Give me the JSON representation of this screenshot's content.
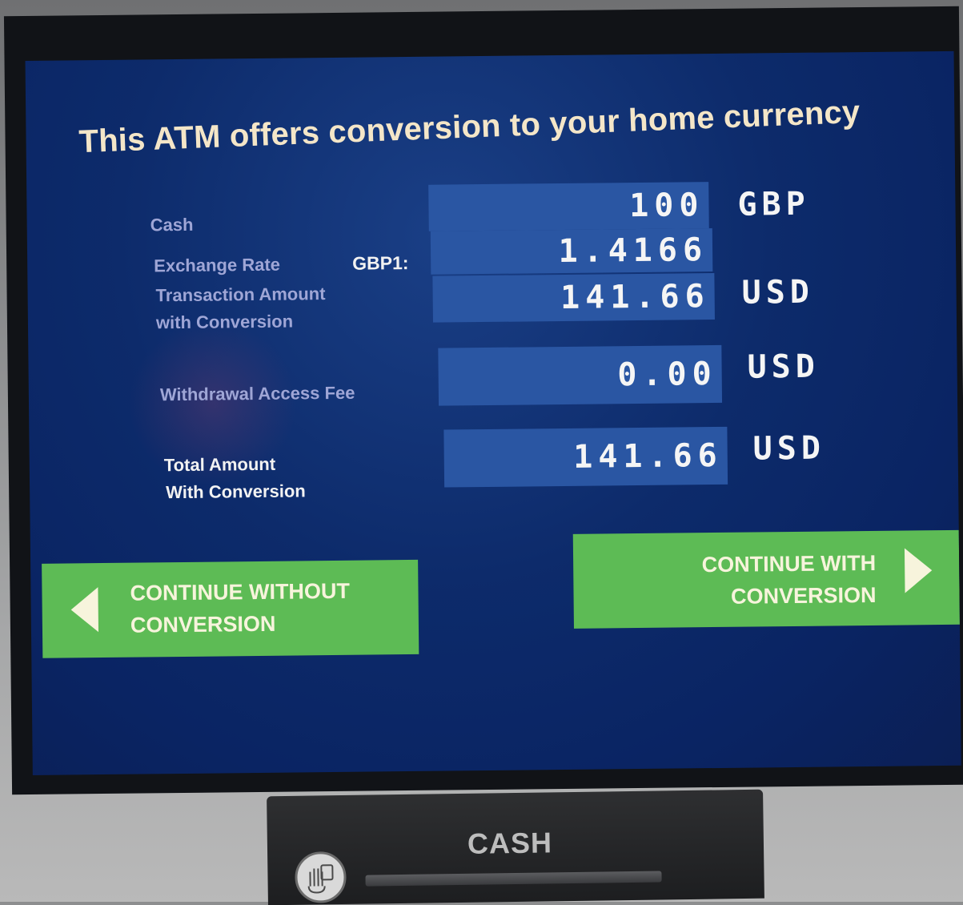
{
  "screen": {
    "title": "This ATM offers conversion to your home currency"
  },
  "rows": {
    "cash": {
      "label": "Cash",
      "value": "100",
      "currency": "GBP"
    },
    "exchange_rate": {
      "label": "Exchange Rate",
      "prefix": "GBP1:",
      "value": "1.4166"
    },
    "transaction_amount": {
      "label_line1": "Transaction Amount",
      "label_line2": "with Conversion",
      "value": "141.66",
      "currency": "USD"
    },
    "withdrawal_fee": {
      "label": "Withdrawal Access Fee",
      "value": "0.00",
      "currency": "USD"
    },
    "total_amount": {
      "label_line1": "Total Amount",
      "label_line2": "With Conversion",
      "value": "141.66",
      "currency": "USD"
    }
  },
  "buttons": {
    "without_conversion": {
      "line1": "CONTINUE WITHOUT",
      "line2": "CONVERSION",
      "icon": "arrow-left-icon"
    },
    "with_conversion": {
      "line1": "CONTINUE WITH",
      "line2": "CONVERSION",
      "icon": "arrow-right-icon"
    }
  },
  "dispenser": {
    "label": "CASH",
    "icon": "hand-card-icon"
  },
  "colors": {
    "screen_bg": "#0d2b6b",
    "value_box": "#2a56a3",
    "button_green": "#5dbb55",
    "title_text": "#f4e6c8"
  }
}
